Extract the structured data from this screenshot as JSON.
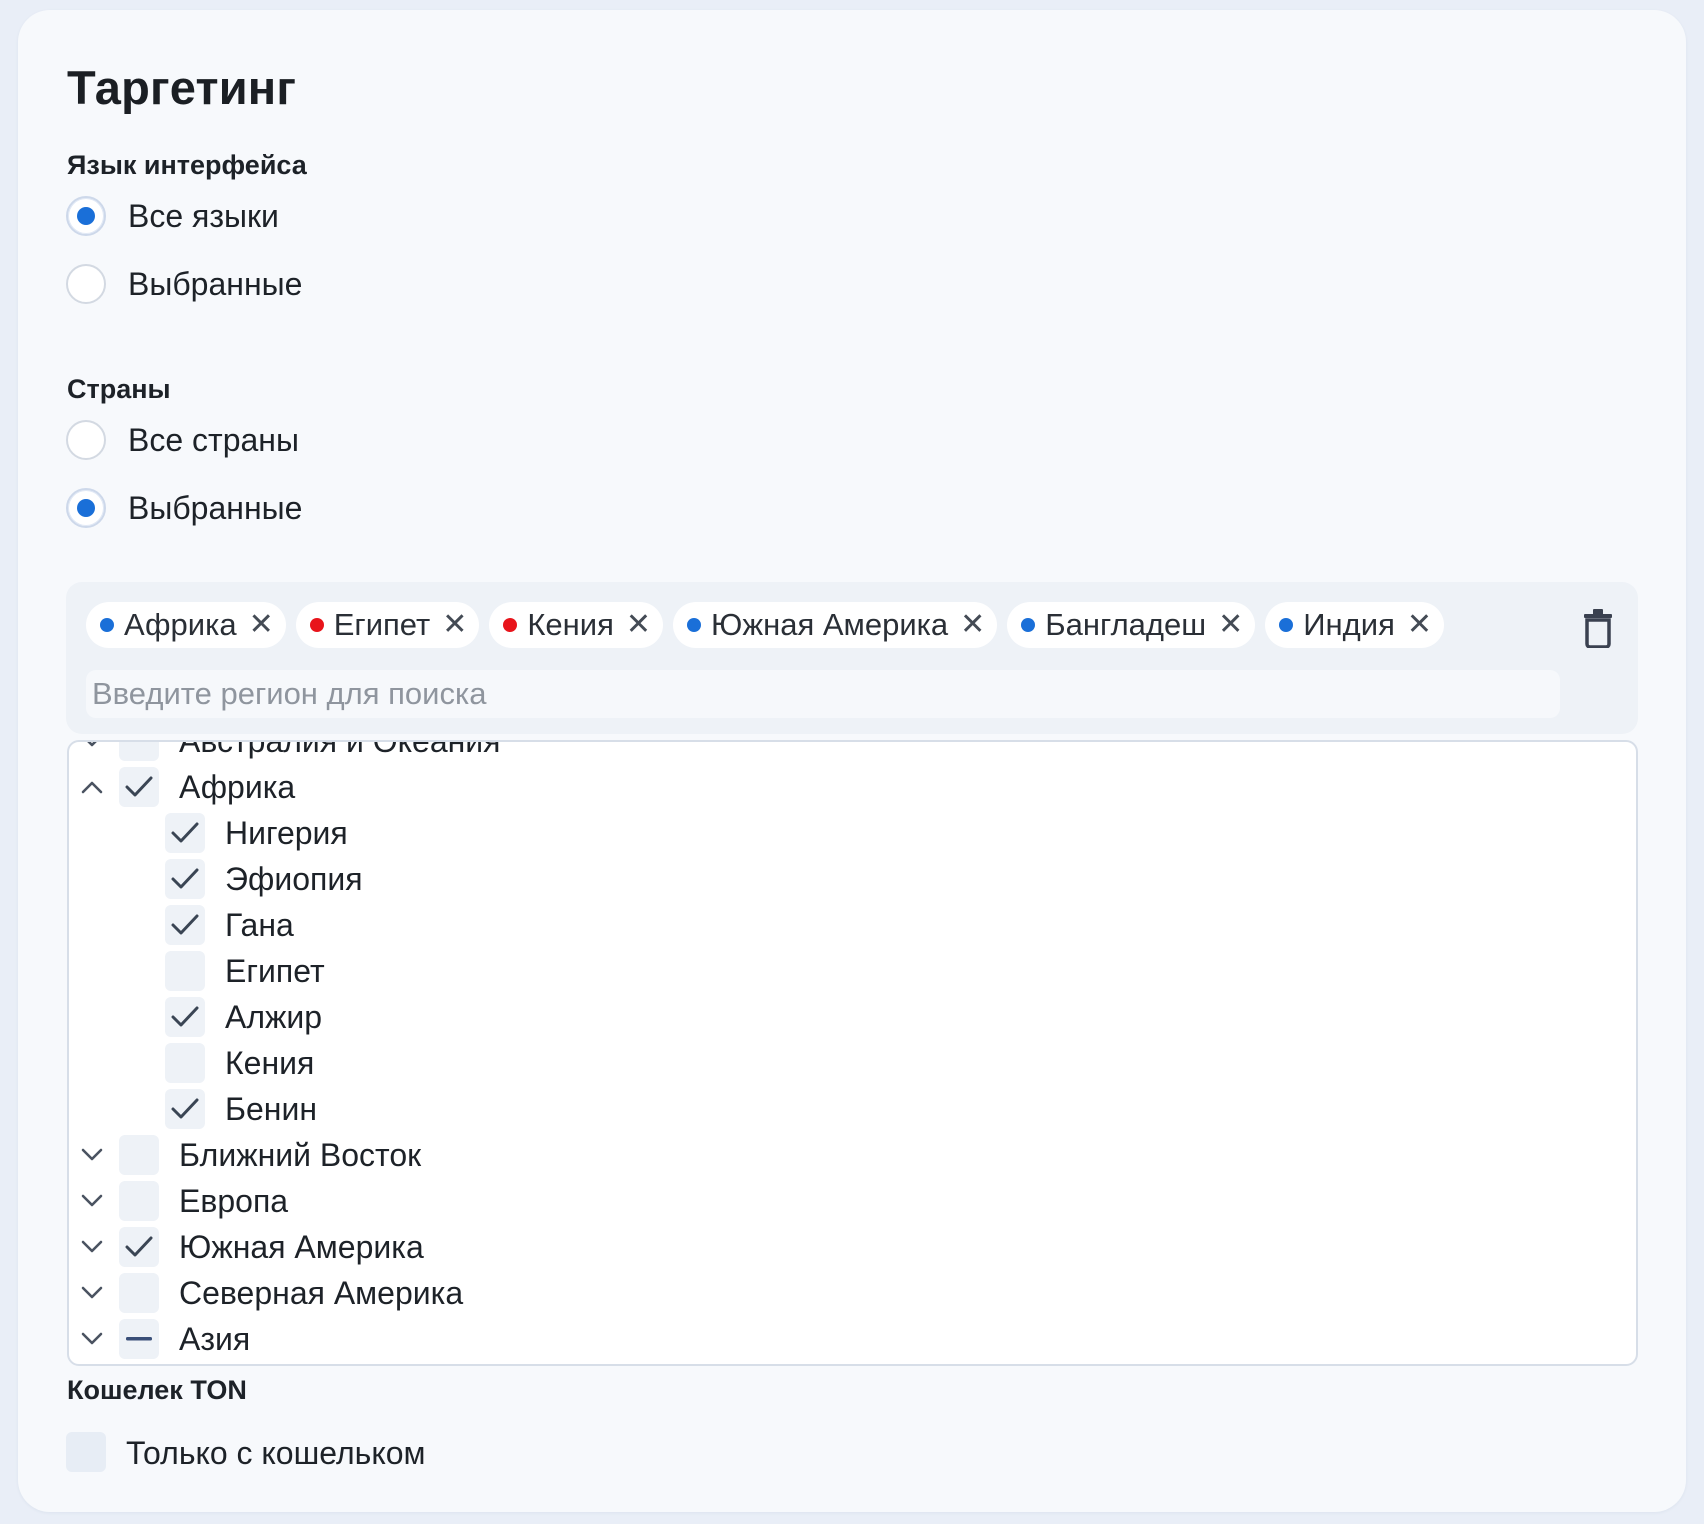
{
  "title": "Таргетинг",
  "language": {
    "label": "Язык интерфейса",
    "options": [
      {
        "label": "Все языки",
        "checked": true
      },
      {
        "label": "Выбранные",
        "checked": false
      }
    ]
  },
  "countries": {
    "label": "Страны",
    "options": [
      {
        "label": "Все страны",
        "checked": false
      },
      {
        "label": "Выбранные",
        "checked": true
      }
    ],
    "tags": [
      {
        "label": "Африка",
        "dot_color": "#1a6fd8"
      },
      {
        "label": "Египет",
        "dot_color": "#e8141b"
      },
      {
        "label": "Кения",
        "dot_color": "#e8141b"
      },
      {
        "label": "Южная Америка",
        "dot_color": "#1a6fd8"
      },
      {
        "label": "Бангладеш",
        "dot_color": "#1a6fd8"
      },
      {
        "label": "Индия",
        "dot_color": "#1a6fd8"
      }
    ],
    "search_placeholder": "Введите регион для поиска",
    "tree": [
      {
        "label": "Австралия и Океания",
        "level": 0,
        "expanded": false,
        "state": "unchecked"
      },
      {
        "label": "Африка",
        "level": 0,
        "expanded": true,
        "state": "checked"
      },
      {
        "label": "Нигерия",
        "level": 1,
        "state": "checked"
      },
      {
        "label": "Эфиопия",
        "level": 1,
        "state": "checked"
      },
      {
        "label": "Гана",
        "level": 1,
        "state": "checked"
      },
      {
        "label": "Египет",
        "level": 1,
        "state": "unchecked"
      },
      {
        "label": "Алжир",
        "level": 1,
        "state": "checked"
      },
      {
        "label": "Кения",
        "level": 1,
        "state": "unchecked"
      },
      {
        "label": "Бенин",
        "level": 1,
        "state": "checked"
      },
      {
        "label": "Ближний Восток",
        "level": 0,
        "expanded": false,
        "state": "unchecked"
      },
      {
        "label": "Европа",
        "level": 0,
        "expanded": false,
        "state": "unchecked"
      },
      {
        "label": "Южная Америка",
        "level": 0,
        "expanded": false,
        "state": "checked"
      },
      {
        "label": "Северная Америка",
        "level": 0,
        "expanded": false,
        "state": "unchecked"
      },
      {
        "label": "Азия",
        "level": 0,
        "expanded": false,
        "state": "indeterminate"
      }
    ]
  },
  "wallet": {
    "label": "Кошелек TON",
    "option": {
      "label": "Только с кошельком",
      "checked": false
    }
  },
  "icons": {
    "tag_remove": "close-icon",
    "clear_all": "trash-icon",
    "expand": "chevron-down-icon",
    "collapse": "chevron-up-icon"
  },
  "colors": {
    "accent": "#1a6fd8",
    "excluded": "#e8141b",
    "check": "#3a4554"
  }
}
